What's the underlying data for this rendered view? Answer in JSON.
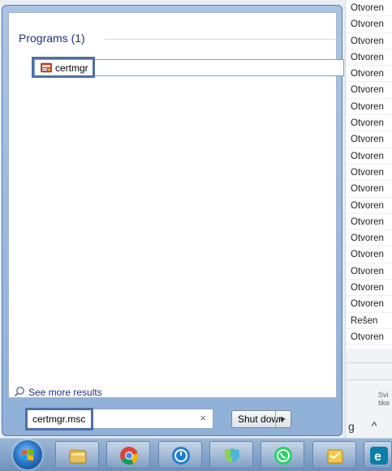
{
  "background_list": {
    "statuses": [
      "Otvoren",
      "Otvoren",
      "Otvoren",
      "Otvoren",
      "Otvoren",
      "Otvoren",
      "Otvoren",
      "Otvoren",
      "Otvoren",
      "Otvoren",
      "Otvoren",
      "Otvoren",
      "Otvoren",
      "Otvoren",
      "Otvoren",
      "Otvoren",
      "Otvoren",
      "Otvoren",
      "Otvoren",
      "Rešen",
      "Otvoren"
    ],
    "fragment_text": "Svi tike",
    "letter": "g",
    "chevron": "^"
  },
  "start_menu": {
    "section_header": "Programs (1)",
    "result": {
      "label": "certmgr",
      "icon": "certificate-manager-icon"
    },
    "see_more_label": "See more results",
    "search": {
      "value": "certmgr.msc",
      "clear_glyph": "×"
    },
    "shutdown": {
      "label": "Shut down",
      "arrow": "▶"
    }
  },
  "taskbar": {
    "items": [
      {
        "name": "start-orb",
        "icon": "windows-logo-icon"
      },
      {
        "name": "explorer",
        "icon": "folder-icon"
      },
      {
        "name": "chrome",
        "icon": "chrome-icon"
      },
      {
        "name": "clock-app",
        "icon": "clock-icon"
      },
      {
        "name": "messaging",
        "icon": "chat-bubble-icon"
      },
      {
        "name": "whatsapp",
        "icon": "whatsapp-icon"
      },
      {
        "name": "notes",
        "icon": "notes-icon"
      },
      {
        "name": "edge",
        "icon": "edge-icon"
      }
    ]
  },
  "colors": {
    "accent_blue": "#1e3287",
    "highlight_border": "#4f6fa6",
    "menu_frame": "#8fb0d7"
  }
}
